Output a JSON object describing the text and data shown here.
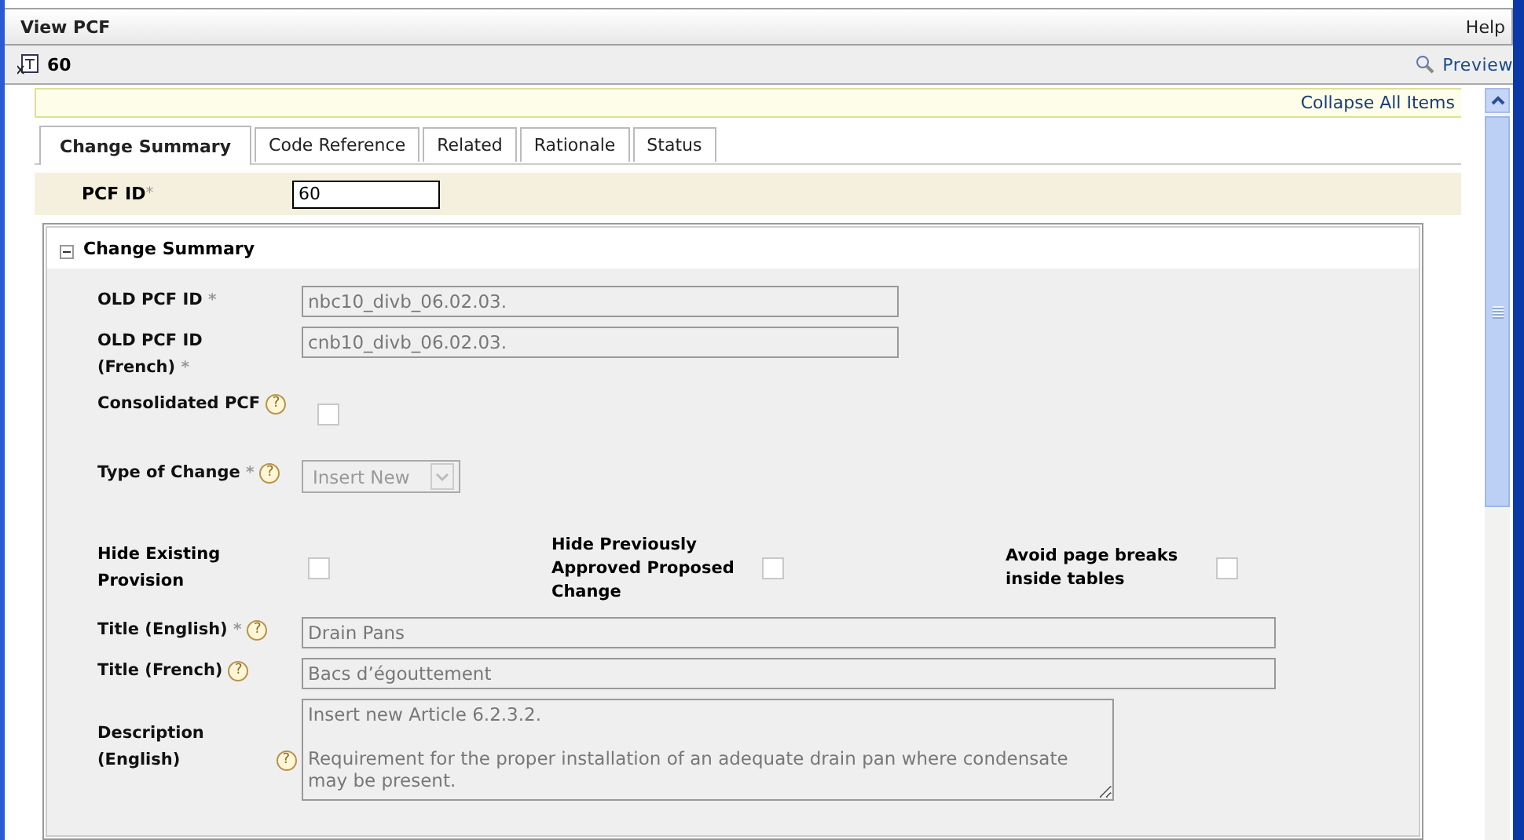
{
  "window": {
    "title": "View PCF",
    "help": "Help"
  },
  "toolbar": {
    "record": "60",
    "preview": "Preview"
  },
  "collapse_all": "Collapse All Items",
  "tabs": [
    {
      "label": "Change Summary",
      "selected": true
    },
    {
      "label": "Code Reference",
      "selected": false
    },
    {
      "label": "Related",
      "selected": false
    },
    {
      "label": "Rationale",
      "selected": false
    },
    {
      "label": "Status",
      "selected": false
    }
  ],
  "pcf_id": {
    "label": "PCF ID",
    "required_mark": "*",
    "value": "60"
  },
  "section": {
    "title": "Change Summary",
    "expanded": true,
    "fields": [
      {
        "kind": "text",
        "label": "OLD PCF ID",
        "required_mark": "*",
        "value": "nbc10_divb_06.02.03.",
        "disabled": true
      },
      {
        "kind": "text",
        "label": "OLD PCF ID (French)",
        "required_mark": "*",
        "value": "cnb10_divb_06.02.03.",
        "disabled": true
      },
      {
        "kind": "checkbox",
        "label": "Consolidated PCF",
        "help": "?",
        "checked": false
      },
      {
        "kind": "select",
        "label": "Type of Change",
        "required_mark": "*",
        "help": "?",
        "value": "Insert New",
        "disabled": true
      },
      {
        "kind": "checks",
        "items": [
          {
            "label": "Hide Existing Provision",
            "checked": false
          },
          {
            "label": "Hide Previously Approved Proposed Change",
            "checked": false
          },
          {
            "label": "Avoid page breaks inside tables",
            "checked": false
          }
        ]
      },
      {
        "kind": "wide",
        "label": "Title (English)",
        "required_mark": "*",
        "help": "?",
        "value": "Drain Pans",
        "disabled": true
      },
      {
        "kind": "wide",
        "label": "Title (French)",
        "help": "?",
        "value": "Bacs d’égouttement",
        "disabled": true
      },
      {
        "kind": "textarea",
        "label": "Description (English)",
        "help": "?",
        "value": "Insert new Article 6.2.3.2.\n\nRequirement for the proper installation of an adequate drain pan where condensate may be present.",
        "disabled": true
      }
    ]
  }
}
